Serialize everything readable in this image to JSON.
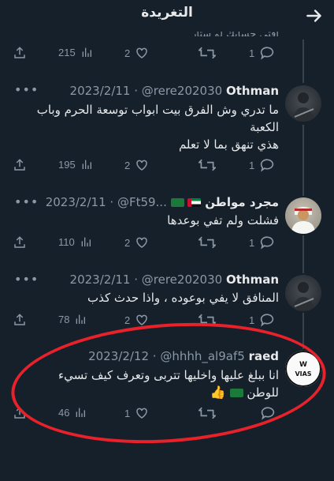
{
  "header": {
    "title": "التغريدة",
    "back_icon": "arrow-right-icon"
  },
  "clipped_text": "اقتي حسابك لو ستار",
  "top_actions": {
    "views": "215",
    "likes": "2",
    "replies": "1"
  },
  "tweets": [
    {
      "name": "Othman",
      "handle": "@rere202030",
      "date": "2023/2/11",
      "text": "ما تدري وش الفرق بيت ابواب توسعة الحرم وباب الكعبة\nهذي تنهق بما لا تعلم",
      "views": "195",
      "likes": "2",
      "replies": "1"
    },
    {
      "name": "مجرد مواطن",
      "handle": "@Ft59...",
      "date": "2023/2/11",
      "text": "فشلت ولم تفي بوعدها",
      "views": "110",
      "likes": "2",
      "replies": "1"
    },
    {
      "name": "Othman",
      "handle": "@rere202030",
      "date": "2023/2/11",
      "text": "المنافق لا يفي بوعوده ، واذا حدث كذب",
      "views": "78",
      "likes": "2",
      "replies": "1"
    },
    {
      "name": "raed",
      "handle": "@hhhh_al9af5",
      "date": "2023/2/12",
      "text": "انا ببلغ عليها واخليها تتربى وتعرف كيف تسيء للوطن",
      "views": "46",
      "likes": "1",
      "replies": ""
    }
  ],
  "colors": {
    "background": "#15202b",
    "text": "#e7e9ea",
    "muted": "#8b98a5",
    "annotation": "#e8212a"
  }
}
